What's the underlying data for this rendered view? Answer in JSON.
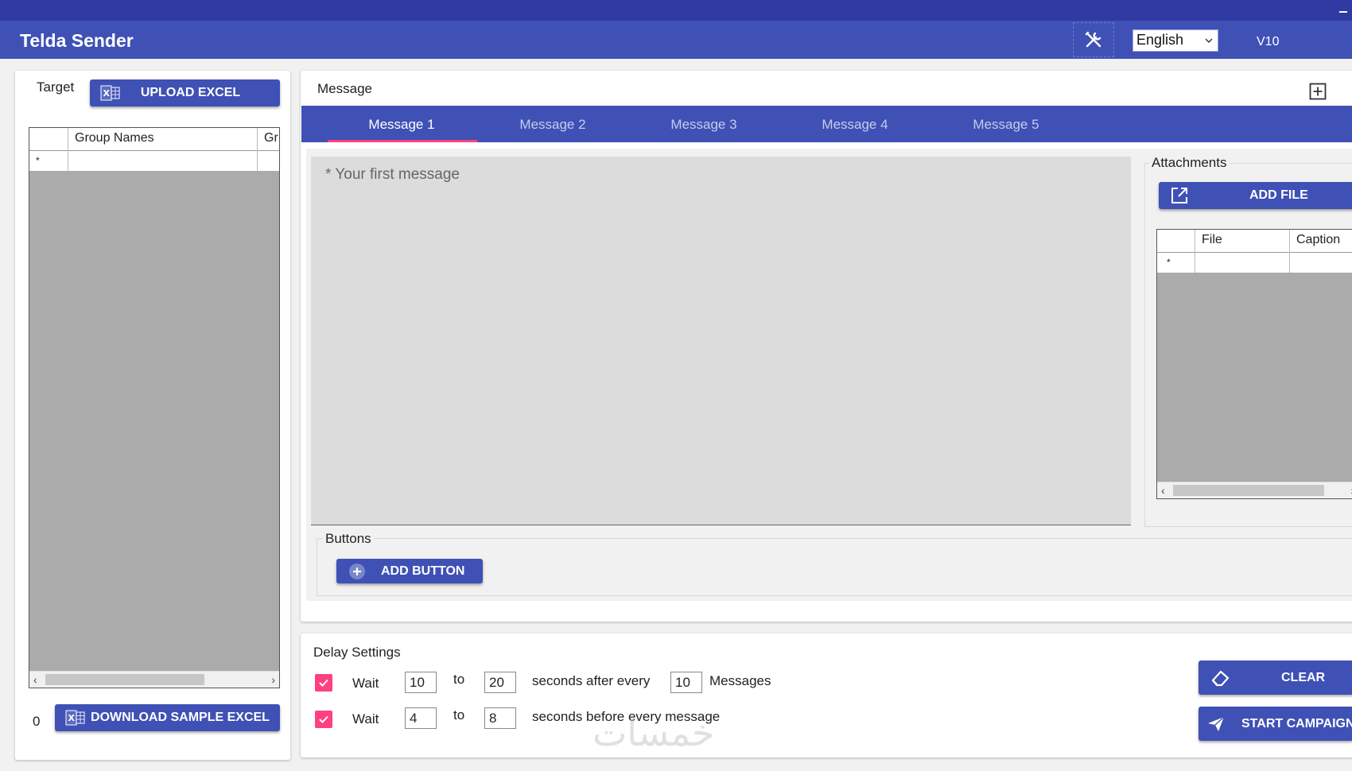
{
  "app": {
    "title": "Telda Sender",
    "language": "English",
    "version": "V10"
  },
  "target": {
    "label": "Target",
    "upload_label": "UPLOAD EXCEL",
    "columns": [
      "Group Names",
      "Gr"
    ],
    "new_row_marker": "*",
    "count": "0",
    "download_label": "DOWNLOAD SAMPLE EXCEL"
  },
  "message": {
    "label": "Message",
    "tabs": [
      "Message 1",
      "Message 2",
      "Message 3",
      "Message 4",
      "Message 5"
    ],
    "placeholder": "* Your first message",
    "buttons_label": "Buttons",
    "add_button_label": "ADD BUTTON"
  },
  "attachments": {
    "label": "Attachments",
    "add_file_label": "ADD FILE",
    "columns": [
      "File",
      "Caption"
    ],
    "new_row_marker": "*"
  },
  "delay": {
    "label": "Delay Settings",
    "row1": {
      "wait": "Wait",
      "from": "10",
      "to_label": "to",
      "to": "20",
      "text": "seconds after every",
      "count": "10",
      "unit": "Messages"
    },
    "row2": {
      "wait": "Wait",
      "from": "4",
      "to_label": "to",
      "to": "8",
      "text": "seconds before every message"
    }
  },
  "actions": {
    "clear_label": "CLEAR",
    "start_label": "START CAMPAIGN"
  },
  "colors": {
    "primary": "#3f51b5",
    "primary_dark": "#2f3ba3",
    "accent": "#ff4081"
  },
  "watermark": "خمسات"
}
